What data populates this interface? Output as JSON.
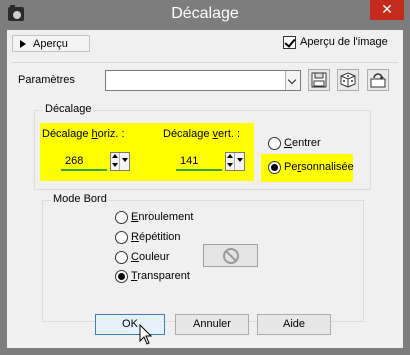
{
  "window": {
    "title": "Décalage",
    "close_glyph": "✕",
    "app_icon": "camera-icon"
  },
  "toolbar": {
    "preview_toggle_label": "Aperçu",
    "preview_image_label": "Aperçu de l'image",
    "preview_image_checked": true
  },
  "settings": {
    "label": "Paramètres",
    "value": "",
    "buttons": [
      "save-preset-icon",
      "random-dice-icon",
      "reset-preset-icon"
    ]
  },
  "offset_group": {
    "legend": "Décalage",
    "horizontal": {
      "label_prefix": "Décalage ",
      "label_underlined": "h",
      "label_rest": "oriz. :",
      "value": "268"
    },
    "vertical": {
      "label_prefix": "Décalage ",
      "label_underlined": "v",
      "label_rest": "ert. :",
      "value": "141"
    },
    "center_label_u": "C",
    "center_label_rest": "entrer",
    "custom_label_prefix": "Pe",
    "custom_label_u": "r",
    "custom_label_rest": "sonnalisée",
    "selected": "custom"
  },
  "edge_group": {
    "legend": "Mode Bord",
    "options": [
      {
        "u": "E",
        "rest": "nroulement",
        "checked": false
      },
      {
        "u": "R",
        "rest": "épétition",
        "checked": false
      },
      {
        "u": "C",
        "rest": "ouleur",
        "checked": false
      },
      {
        "u": "T",
        "rest": "ransparent",
        "checked": true
      }
    ],
    "color_swatch_icon": "disabled-circle-icon"
  },
  "footer": {
    "ok_label": "OK",
    "cancel_label": "Annuler",
    "help_label": "Aide"
  },
  "colors": {
    "highlight": "#ffff00",
    "title_bar": "#7d7d7d",
    "close": "#c42b1c",
    "underline_green": "#3aa33a"
  }
}
